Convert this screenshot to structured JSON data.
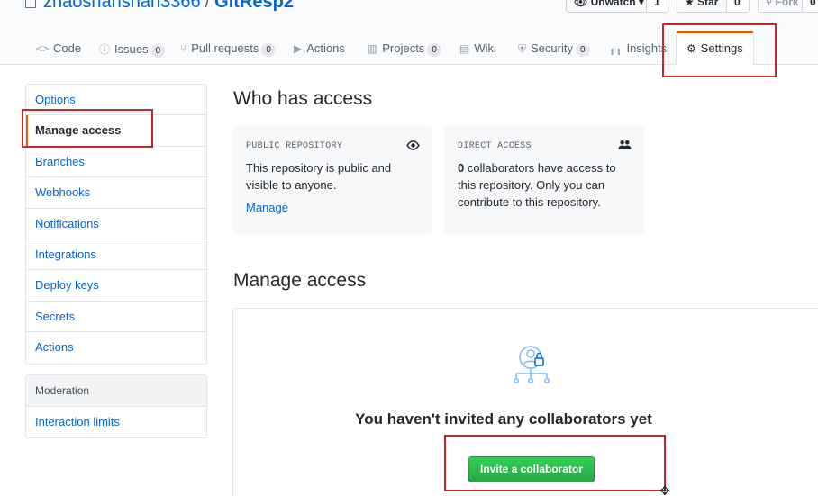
{
  "repo": {
    "owner": "zhaoshanshan3366",
    "separator": "/",
    "name": "GitResp2"
  },
  "header_buttons": {
    "watch_label": "Unwatch ▾",
    "watch_count": "1",
    "star_label": "Star",
    "star_count": "0",
    "fork_label": "Fork",
    "fork_count": "0"
  },
  "tabs": [
    {
      "label": "Code",
      "icon": "<>",
      "count": null
    },
    {
      "label": "Issues",
      "icon": "ⓘ",
      "count": "0"
    },
    {
      "label": "Pull requests",
      "icon": "⑂",
      "count": "0"
    },
    {
      "label": "Actions",
      "icon": "▶",
      "count": null
    },
    {
      "label": "Projects",
      "icon": "▥",
      "count": "0"
    },
    {
      "label": "Wiki",
      "icon": "▤",
      "count": null
    },
    {
      "label": "Security",
      "icon": "⛨",
      "count": "0"
    },
    {
      "label": "Insights",
      "icon": "╻╻",
      "count": null
    },
    {
      "label": "Settings",
      "icon": "⚙",
      "count": null
    }
  ],
  "sidebar": {
    "items": [
      {
        "label": "Options"
      },
      {
        "label": "Manage access"
      },
      {
        "label": "Branches"
      },
      {
        "label": "Webhooks"
      },
      {
        "label": "Notifications"
      },
      {
        "label": "Integrations"
      },
      {
        "label": "Deploy keys"
      },
      {
        "label": "Secrets"
      },
      {
        "label": "Actions"
      }
    ],
    "moderation": {
      "heading": "Moderation",
      "items": [
        {
          "label": "Interaction limits"
        }
      ]
    }
  },
  "main": {
    "who_title": "Who has access",
    "public_card": {
      "label": "PUBLIC REPOSITORY",
      "text": "This repository is public and visible to anyone.",
      "link": "Manage"
    },
    "direct_card": {
      "label": "DIRECT ACCESS",
      "count": "0",
      "text": " collaborators have access to this repository. Only you can contribute to this repository."
    },
    "manage_title": "Manage access",
    "blank_heading": "You haven't invited any collaborators yet",
    "invite_button": "Invite a collaborator"
  },
  "colors": {
    "accent_orange": "#e36209",
    "link_blue": "#0366d6",
    "button_green": "#28a745",
    "highlight_red": "#c62828",
    "icon_blue": "#79b8ff"
  }
}
